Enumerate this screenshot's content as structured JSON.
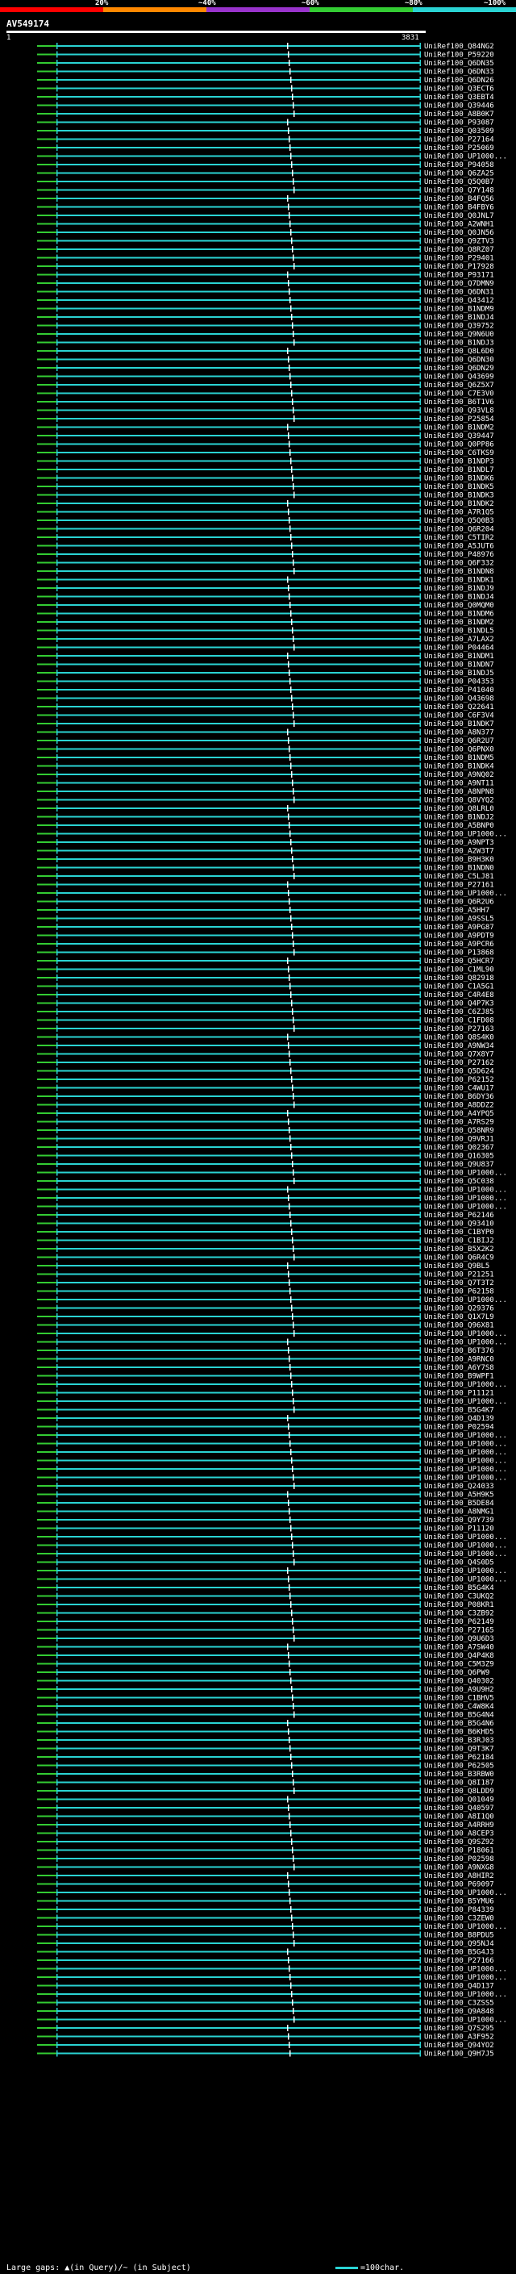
{
  "scale": {
    "segments": [
      {
        "color": "#ff0000",
        "label": ""
      },
      {
        "color": "#ff8800",
        "label": "20%"
      },
      {
        "color": "#9933cc",
        "label": "~40%"
      },
      {
        "color": "#33cc33",
        "label": "~60%"
      },
      {
        "color": "#2ad3d3",
        "label": "~80%"
      }
    ],
    "last_label": "~100%"
  },
  "query": {
    "name": "AV549174",
    "start": "1",
    "end": "3831"
  },
  "colors": {
    "hit": "#2ad3d3",
    "gap": "#33cc33",
    "marker": "#ffffff"
  },
  "hits": [
    "UniRef100_Q84NG2",
    "UniRef100_P59220",
    "UniRef100_Q6DN35",
    "UniRef100_Q6DN33",
    "UniRef100_Q6DN26",
    "UniRef100_Q3ECT6",
    "UniRef100_Q3EBT4",
    "UniRef100_Q39446",
    "UniRef100_A8B0K7",
    "UniRef100_P93087",
    "UniRef100_Q03509",
    "UniRef100_P27164",
    "UniRef100_P25069",
    "UniRef100_UP1000...",
    "UniRef100_P94058",
    "UniRef100_Q6ZA25",
    "UniRef100_Q5Q0B7",
    "UniRef100_Q7Y148",
    "UniRef100_B4FQ56",
    "UniRef100_B4FBY6",
    "UniRef100_Q0JNL7",
    "UniRef100_A2WNH1",
    "UniRef100_Q0JN56",
    "UniRef100_Q9ZTV3",
    "UniRef100_Q8RZ07",
    "UniRef100_P29401",
    "UniRef100_P17928",
    "UniRef100_P93171",
    "UniRef100_Q7DMN9",
    "UniRef100_Q6DN31",
    "UniRef100_Q43412",
    "UniRef100_B1NDM9",
    "UniRef100_B1NDJ4",
    "UniRef100_Q39752",
    "UniRef100_Q9N6U0",
    "UniRef100_B1NDJ3",
    "UniRef100_Q8L6D0",
    "UniRef100_Q6DN30",
    "UniRef100_Q6DN29",
    "UniRef100_Q43699",
    "UniRef100_Q6Z5X7",
    "UniRef100_C7E3V0",
    "UniRef100_B6T1V6",
    "UniRef100_Q93VL8",
    "UniRef100_P25854",
    "UniRef100_B1NDM2",
    "UniRef100_Q39447",
    "UniRef100_Q0PP86",
    "UniRef100_C6TKS9",
    "UniRef100_B1NDP3",
    "UniRef100_B1NDL7",
    "UniRef100_B1NDK6",
    "UniRef100_B1NDK5",
    "UniRef100_B1NDK3",
    "UniRef100_B1NDK2",
    "UniRef100_A7R1Q5",
    "UniRef100_Q5Q0B3",
    "UniRef100_Q6R204",
    "UniRef100_C5TIR2",
    "UniRef100_A5JUT6",
    "UniRef100_P48976",
    "UniRef100_Q6F332",
    "UniRef100_B1NDN8",
    "UniRef100_B1NDK1",
    "UniRef100_B1NDJ9",
    "UniRef100_B1NDJ4",
    "UniRef100_Q0MQM0",
    "UniRef100_B1NDM6",
    "UniRef100_B1NDM2",
    "UniRef100_B1NDL5",
    "UniRef100_A7LAX2",
    "UniRef100_P04464",
    "UniRef100_B1NDM1",
    "UniRef100_B1NDN7",
    "UniRef100_B1NDJ5",
    "UniRef100_P04353",
    "UniRef100_P41040",
    "UniRef100_Q43698",
    "UniRef100_Q22641",
    "UniRef100_C6F3V4",
    "UniRef100_B1NDK7",
    "UniRef100_A8N377",
    "UniRef100_Q6R2U7",
    "UniRef100_Q6PNX0",
    "UniRef100_B1NDM5",
    "UniRef100_B1NDK4",
    "UniRef100_A9NQ02",
    "UniRef100_A9NT11",
    "UniRef100_A8NPN8",
    "UniRef100_Q8VYQ2",
    "UniRef100_Q8LRL0",
    "UniRef100_B1NDJ2",
    "UniRef100_A5BNP0",
    "UniRef100_UP1000...",
    "UniRef100_A9NPT3",
    "UniRef100_A2W3T7",
    "UniRef100_B9H3K0",
    "UniRef100_B1NDN0",
    "UniRef100_C5LJ81",
    "UniRef100_P27161",
    "UniRef100_UP1000...",
    "UniRef100_Q6R2U6",
    "UniRef100_A5HH7",
    "UniRef100_A9SSL5",
    "UniRef100_A9PG87",
    "UniRef100_A9PDT9",
    "UniRef100_A9PCR6",
    "UniRef100_P13868",
    "UniRef100_Q5HCR7",
    "UniRef100_C1ML90",
    "UniRef100_Q82918",
    "UniRef100_C1A5G1",
    "UniRef100_C4R4E8",
    "UniRef100_Q4P7K3",
    "UniRef100_C6ZJ85",
    "UniRef100_C1FD08",
    "UniRef100_P27163",
    "UniRef100_Q8S4K0",
    "UniRef100_A9NW34",
    "UniRef100_Q7X8Y7",
    "UniRef100_P27162",
    "UniRef100_Q5D624",
    "UniRef100_P62152",
    "UniRef100_C4WU17",
    "UniRef100_B6DY36",
    "UniRef100_A8DDZ2",
    "UniRef100_A4YPQ5",
    "UniRef100_A7RS29",
    "UniRef100_Q58NR9",
    "UniRef100_Q9VRJ1",
    "UniRef100_Q02367",
    "UniRef100_Q16305",
    "UniRef100_Q9U837",
    "UniRef100_UP1000...",
    "UniRef100_Q5C038",
    "UniRef100_UP1000...",
    "UniRef100_UP1000...",
    "UniRef100_UP1000...",
    "UniRef100_P62146",
    "UniRef100_Q93410",
    "UniRef100_C1BYP0",
    "UniRef100_C1BIJ2",
    "UniRef100_B5X2K2",
    "UniRef100_Q6R4C9",
    "UniRef100_Q9BL5",
    "UniRef100_P21251",
    "UniRef100_Q7T3T2",
    "UniRef100_P62158",
    "UniRef100_UP1000...",
    "UniRef100_Q29376",
    "UniRef100_Q1X7L9",
    "UniRef100_Q96X81",
    "UniRef100_UP1000...",
    "UniRef100_UP1000...",
    "UniRef100_B6T376",
    "UniRef100_A9RNC0",
    "UniRef100_A6Y7S8",
    "UniRef100_B9WPF1",
    "UniRef100_UP1000...",
    "UniRef100_P11121",
    "UniRef100_UP1000...",
    "UniRef100_B5G4K7",
    "UniRef100_Q4D139",
    "UniRef100_P02594",
    "UniRef100_UP1000...",
    "UniRef100_UP1000...",
    "UniRef100_UP1000...",
    "UniRef100_UP1000...",
    "UniRef100_UP1000...",
    "UniRef100_UP1000...",
    "UniRef100_Q24033",
    "UniRef100_A5H9K5",
    "UniRef100_B5DE84",
    "UniRef100_A8NMG1",
    "UniRef100_Q9Y739",
    "UniRef100_P11120",
    "UniRef100_UP1000...",
    "UniRef100_UP1000...",
    "UniRef100_UP1000...",
    "UniRef100_Q4S0D5",
    "UniRef100_UP1000...",
    "UniRef100_UP1000...",
    "UniRef100_B5G4K4",
    "UniRef100_C3UKQ2",
    "UniRef100_P08KR1",
    "UniRef100_C3ZB92",
    "UniRef100_P62149",
    "UniRef100_P27165",
    "UniRef100_Q9U6D3",
    "UniRef100_A7SW40",
    "UniRef100_Q4P4K8",
    "UniRef100_C5M3Z9",
    "UniRef100_Q6PW9",
    "UniRef100_Q40302",
    "UniRef100_A9U9H2",
    "UniRef100_C1BHV5",
    "UniRef100_C4W8K4",
    "UniRef100_B5G4N4",
    "UniRef100_B5G4N6",
    "UniRef100_B6KHD5",
    "UniRef100_B3RJ03",
    "UniRef100_Q9T3K7",
    "UniRef100_P62184",
    "UniRef100_P62505",
    "UniRef100_B3RBW0",
    "UniRef100_Q8I187",
    "UniRef100_Q8LDD9",
    "UniRef100_Q01049",
    "UniRef100_Q40597",
    "UniRef100_A8I1Q0",
    "UniRef100_A4RRH9",
    "UniRef100_A8CEP3",
    "UniRef100_Q9SZ92",
    "UniRef100_P18061",
    "UniRef100_P02598",
    "UniRef100_A9NXG8",
    "UniRef100_A8HIR2",
    "UniRef100_P69097",
    "UniRef100_UP1000...",
    "UniRef100_B5YMU6",
    "UniRef100_P84339",
    "UniRef100_C3ZEW0",
    "UniRef100_UP1000...",
    "UniRef100_B8PDU5",
    "UniRef100_Q95NJ4",
    "UniRef100_B5G4J3",
    "UniRef100_P27166",
    "UniRef100_UP1000...",
    "UniRef100_UP1000...",
    "UniRef100_Q4D137",
    "UniRef100_UP1000...",
    "UniRef100_C3ZSS5",
    "UniRef100_Q9A848",
    "UniRef100_UP1000...",
    "UniRef100_Q7S295",
    "UniRef100_A3F952",
    "UniRef100_Q94YO2",
    "UniRef100_Q9H7J5"
  ],
  "footer": {
    "left": "Large gaps: ▲(in Query)/~ (in Subject)",
    "right": "=100char."
  }
}
